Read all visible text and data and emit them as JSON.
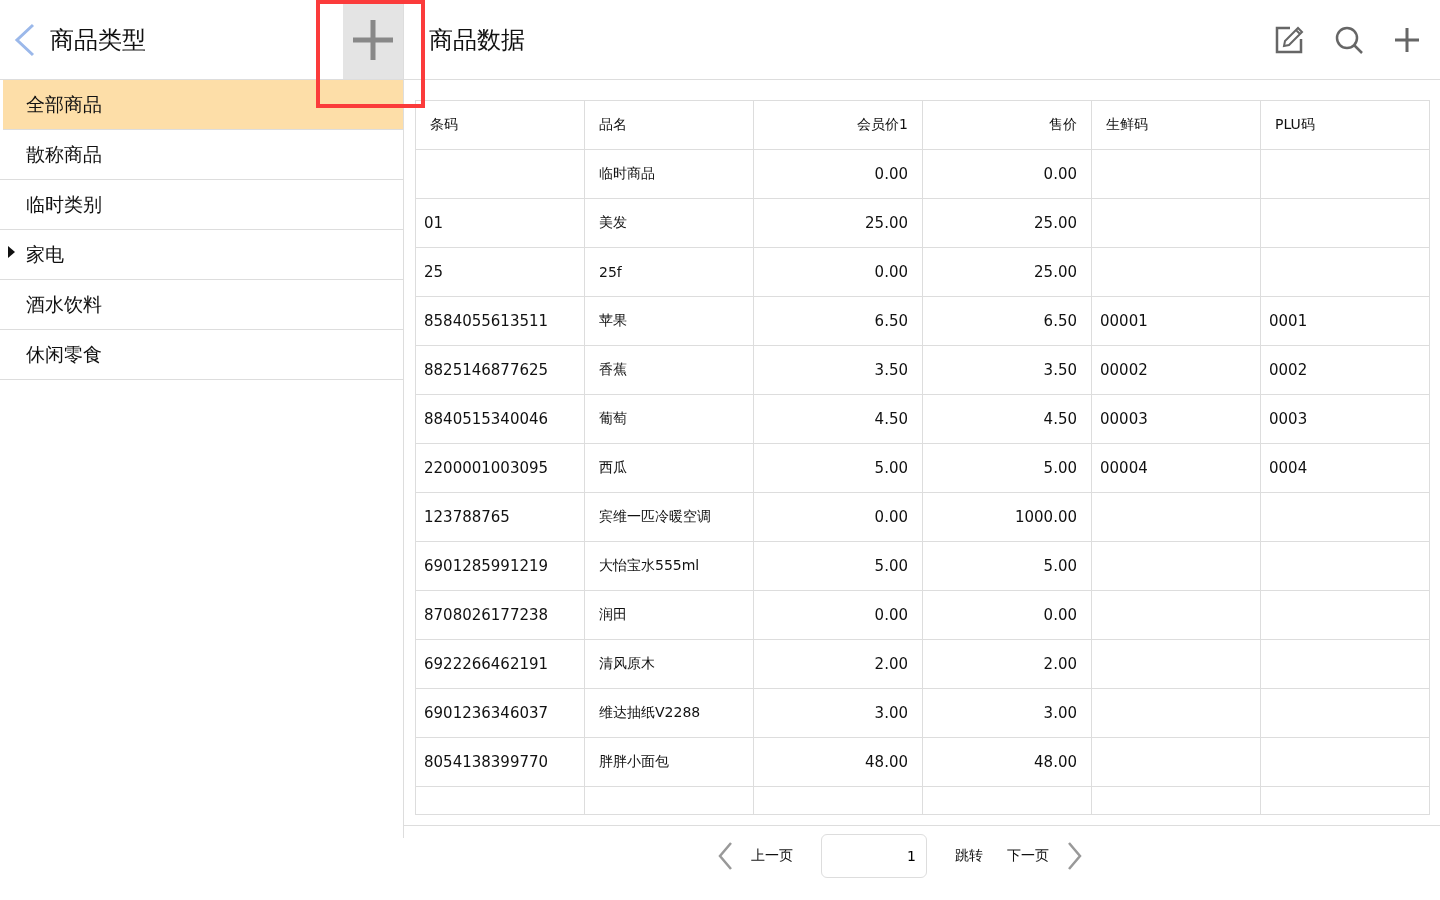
{
  "sidebar": {
    "title": "商品类型",
    "items": [
      {
        "label": "全部商品",
        "selected": true,
        "kind": "leaf"
      },
      {
        "label": "散称商品",
        "selected": false,
        "kind": "leaf"
      },
      {
        "label": "临时类别",
        "selected": false,
        "kind": "leaf"
      },
      {
        "label": "家电",
        "selected": false,
        "kind": "group"
      },
      {
        "label": "酒水饮料",
        "selected": false,
        "kind": "leaf"
      },
      {
        "label": "休闲零食",
        "selected": false,
        "kind": "leaf"
      }
    ]
  },
  "content": {
    "title": "商品数据"
  },
  "table": {
    "columns": [
      {
        "label": "条码",
        "kind": "text"
      },
      {
        "label": "品名",
        "kind": "text"
      },
      {
        "label": "会员价1",
        "kind": "number"
      },
      {
        "label": "售价",
        "kind": "number"
      },
      {
        "label": "生鲜码",
        "kind": "text"
      },
      {
        "label": "PLU码",
        "kind": "text"
      }
    ],
    "rows": [
      [
        "",
        "临时商品",
        "0.00",
        "0.00",
        "",
        ""
      ],
      [
        "01",
        "美发",
        "25.00",
        "25.00",
        "",
        ""
      ],
      [
        "25",
        "25f",
        "0.00",
        "25.00",
        "",
        ""
      ],
      [
        "8584055613511",
        "苹果",
        "6.50",
        "6.50",
        "00001",
        "0001"
      ],
      [
        "8825146877625",
        "香蕉",
        "3.50",
        "3.50",
        "00002",
        "0002"
      ],
      [
        "8840515340046",
        "葡萄",
        "4.50",
        "4.50",
        "00003",
        "0003"
      ],
      [
        "2200001003095",
        "西瓜",
        "5.00",
        "5.00",
        "00004",
        "0004"
      ],
      [
        "123788765",
        "宾维一匹冷暖空调",
        "0.00",
        "1000.00",
        "",
        ""
      ],
      [
        "6901285991219",
        "大怡宝水555ml",
        "5.00",
        "5.00",
        "",
        ""
      ],
      [
        "8708026177238",
        "润田",
        "0.00",
        "0.00",
        "",
        ""
      ],
      [
        "6922266462191",
        "清风原木",
        "2.00",
        "2.00",
        "",
        ""
      ],
      [
        "6901236346037",
        "维达抽纸V2288",
        "3.00",
        "3.00",
        "",
        ""
      ],
      [
        "8054138399770",
        "胖胖小面包",
        "48.00",
        "48.00",
        "",
        ""
      ]
    ]
  },
  "pagination": {
    "prev": "上一页",
    "page": "1",
    "jump": "跳转",
    "next": "下一页"
  }
}
